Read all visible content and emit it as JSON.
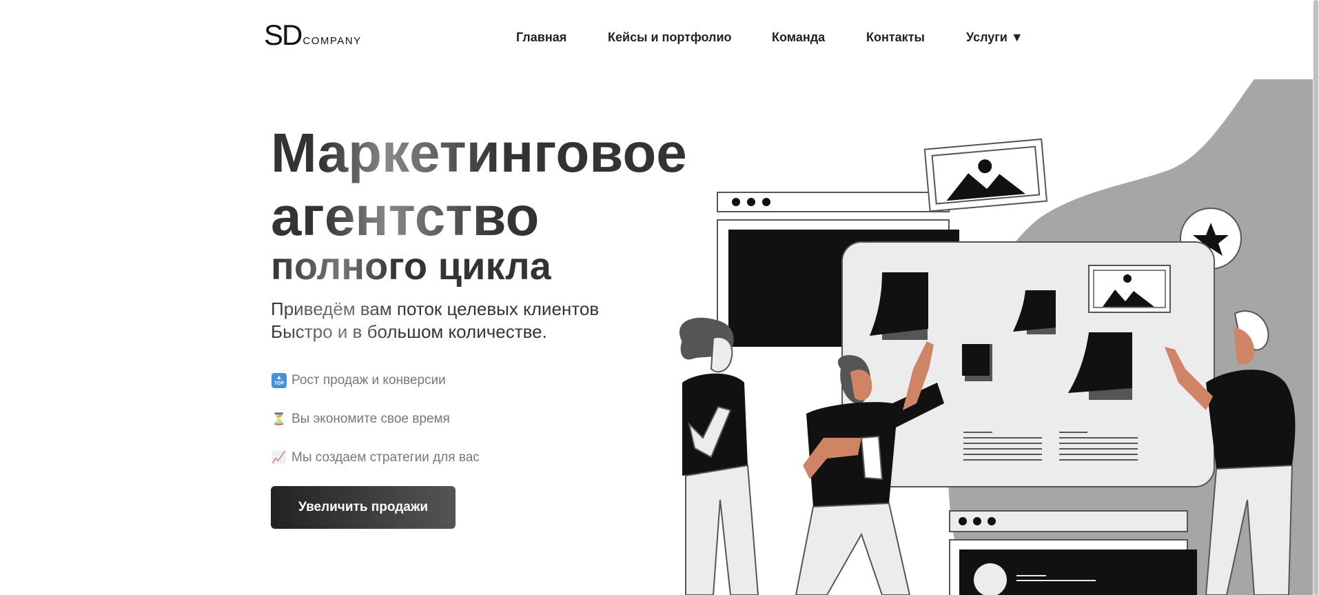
{
  "header": {
    "logo": {
      "primary": "SD",
      "secondary": "COMPANY"
    },
    "nav": [
      {
        "label": "Главная"
      },
      {
        "label": "Кейсы и портфолио"
      },
      {
        "label": "Команда"
      },
      {
        "label": "Контакты"
      },
      {
        "label": "Услуги ▼"
      }
    ]
  },
  "hero": {
    "title_line1": "Маркетинговое",
    "title_line2": "агентство",
    "subtitle": "полного цикла",
    "lead_line1": "Приведём вам поток целевых клиентов",
    "lead_line2": "Быстро и в большом количестве.",
    "features": [
      {
        "icon": "top-arrow-icon",
        "icon_text": "TOP",
        "text": "Рост продаж и конверсии"
      },
      {
        "icon": "hourglass-icon",
        "icon_text": "⏳",
        "text": "Вы экономите свое время"
      },
      {
        "icon": "chart-up-icon",
        "icon_text": "📈",
        "text": "Мы создаем стратегии для вас"
      }
    ],
    "cta_label": "Увеличить продажи"
  },
  "colors": {
    "accent_dark": "#222222",
    "illustration_gray": "#a6a6a6",
    "skin": "#d08466"
  }
}
